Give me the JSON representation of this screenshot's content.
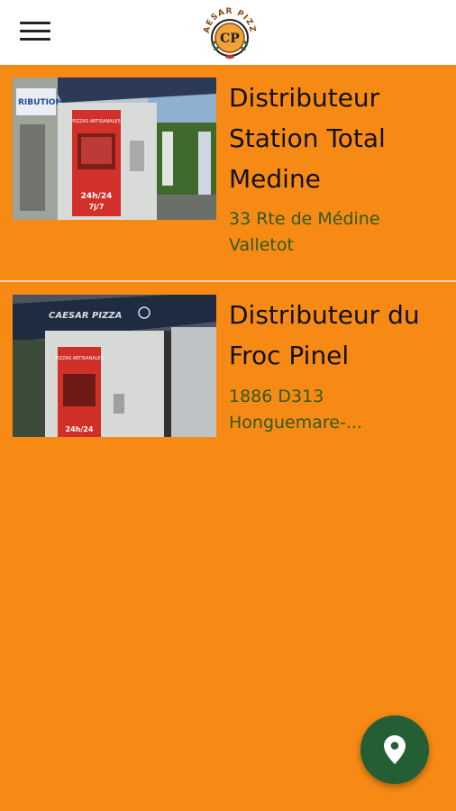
{
  "header": {
    "logo_text": "CAESAR PIZZA",
    "logo_monogram": "CP",
    "menu_icon": "hamburger-menu-icon"
  },
  "locations": [
    {
      "title_lines": [
        "Distributeur",
        "Station Total",
        "Medine"
      ],
      "address_lines": [
        "33 Rte de Médine",
        "Valletot"
      ],
      "photo_text": [
        "RIBUTION",
        "PIZZAS ARTISANALES",
        "24h/24",
        "7j/7"
      ]
    },
    {
      "title_lines": [
        "Distributeur du",
        "Froc Pinel"
      ],
      "address_lines": [
        "1886 D313",
        "Honguemare-..."
      ],
      "photo_text": [
        "CAESAR PIZZA",
        "PIZZAS ARTISANALES",
        "24h/24"
      ]
    }
  ],
  "fab": {
    "icon": "map-pin-icon"
  },
  "colors": {
    "background": "#f78a14",
    "app_bar": "#ffffff",
    "address_text": "#2f5a1d",
    "fab": "#235e35",
    "logo_brown": "#8a4a12"
  }
}
